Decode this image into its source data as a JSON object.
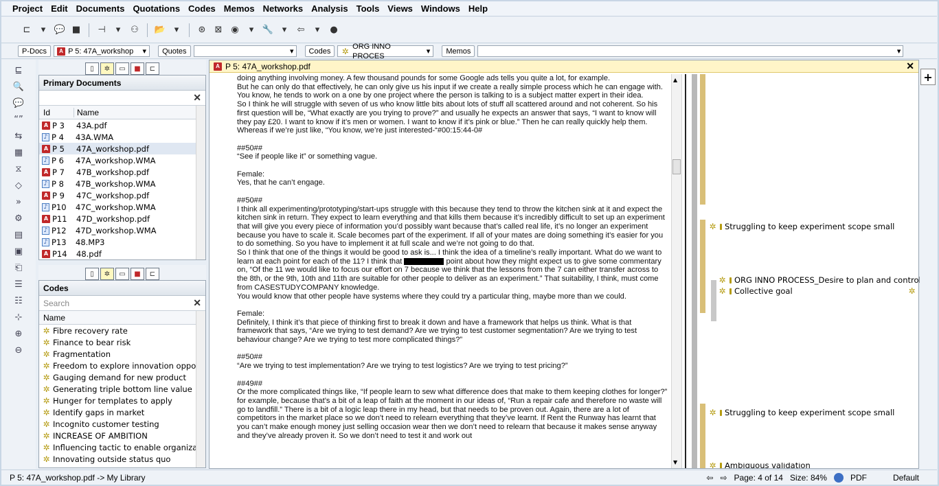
{
  "menu": [
    "Project",
    "Edit",
    "Documents",
    "Quotations",
    "Codes",
    "Memos",
    "Networks",
    "Analysis",
    "Tools",
    "Views",
    "Windows",
    "Help"
  ],
  "managers": {
    "pdocs_label": "P-Docs",
    "pdoc_selected": "P 5: 47A_workshop",
    "quotes_label": "Quotes",
    "codes_label": "Codes",
    "code_selected": "ORG INNO PROCES",
    "memos_label": "Memos"
  },
  "primary_documents": {
    "title": "Primary Documents",
    "col_id": "Id",
    "col_name": "Name",
    "rows": [
      {
        "id": "P 3",
        "name": "43A.pdf",
        "type": "pdf"
      },
      {
        "id": "P 4",
        "name": "43A.WMA",
        "type": "wma"
      },
      {
        "id": "P 5",
        "name": "47A_workshop.pdf",
        "type": "pdf"
      },
      {
        "id": "P 6",
        "name": "47A_workshop.WMA",
        "type": "wma"
      },
      {
        "id": "P 7",
        "name": "47B_workshop.pdf",
        "type": "pdf"
      },
      {
        "id": "P 8",
        "name": "47B_workshop.WMA",
        "type": "wma"
      },
      {
        "id": "P 9",
        "name": "47C_workshop.pdf",
        "type": "pdf"
      },
      {
        "id": "P10",
        "name": "47C_workshop.WMA",
        "type": "wma"
      },
      {
        "id": "P11",
        "name": "47D_workshop.pdf",
        "type": "pdf"
      },
      {
        "id": "P12",
        "name": "47D_workshop.WMA",
        "type": "wma"
      },
      {
        "id": "P13",
        "name": "48.MP3",
        "type": "wma"
      },
      {
        "id": "P14",
        "name": "48.pdf",
        "type": "pdf"
      }
    ]
  },
  "codes_panel": {
    "title": "Codes",
    "search_placeholder": "Search",
    "col_name": "Name",
    "items": [
      "Fibre recovery rate",
      "Finance to bear risk",
      "Fragmentation",
      "Freedom to explore innovation oppo...",
      "Gauging demand for new product",
      "Generating triple bottom line value",
      "Hunger for templates to apply",
      "Identify gaps in market",
      "Incognito customer testing",
      "INCREASE OF AMBITION",
      "Influencing tactic to enable organiza...",
      "Innovating outside status quo"
    ]
  },
  "document": {
    "title": "P 5: 47A_workshop.pdf",
    "paragraphs": [
      "doing anything involving money. A few thousand pounds for some Google ads tells you quite a lot, for example.",
      "But he can only do that effectively, he can only give us his input if we create a really simple process which he can engage with. You know, he tends to work on a one by one project where the person is talking to is a subject matter expert in their idea.",
      "So I think he will struggle with seven of us who know little bits about lots of stuff all scattered around and not coherent. So his first question will be, “What exactly are you trying to prove?” and usually he expects an answer that says, “I want to know will they pay £20. I want to know if it’s men or women. I want to know if it’s pink or blue.” Then he can really quickly help them.",
      "Whereas if we’re just like, “You know, we’re just interested-“#00:15:44-0#",
      "",
      "##50##",
      "“See if people like it” or something vague.",
      "",
      "Female:",
      "Yes, that he can’t engage.",
      "",
      "##50##",
      "I think all experimenting/prototyping/start-ups struggle with this because they tend to throw the kitchen sink at it and expect the kitchen sink in return. They expect to learn everything and that kills them because it’s incredibly difficult to set up an experiment that will give you every piece of information you’d possibly want because that’s called real life, it’s no longer an experiment because you have to scale it. Scale becomes part of the experiment. If all of your mates are doing something it’s easier for you to do something. So you have to implement it at full scale and we’re not going to do that."
    ],
    "para_redacted_before": "So I think that one of the things it would be good to ask is... I think the idea of a timeline’s really important. What do we want to learn at each point for each of the 11? I think that",
    "para_redacted_after": "point about how they might expect us to give some commentary on, “Of the 11 we would like to focus our effort on 7 because we think that the lessons from the 7 can either transfer across to the 8th, or the 9th, 10th and 11th are suitable for other people to deliver as an experiment.” That suitability, I think, must come from CASESTUDYCOMPANY knowledge.",
    "paragraphs2": [
      "You would know that other people have systems where they could try a particular thing, maybe more than we could.",
      "",
      "Female:",
      "Definitely, I think it’s that piece of thinking first to break it down and have a framework that helps us think. What is that framework that says, “Are we trying to test demand? Are we trying to test customer segmentation? Are we trying to test behaviour change? Are we trying to test more complicated things?”",
      "",
      "##50##",
      "“Are we trying to test implementation? Are we trying to test logistics? Are we trying to test pricing?”",
      "",
      "##49##",
      "Or the more complicated things like, “If people learn to sew what difference does that make to them keeping clothes for longer?” for example, because that’s a bit of a leap of faith at the moment in our ideas of, “Run a repair cafe and therefore no waste will go to landfill.” There is a bit of a logic leap there in my head, but that needs to be proven out. Again, there are a lot of competitors in the market place so we don’t need to relearn everything that they’ve learnt. If Rent the Runway has learnt that you can’t make enough money just selling occasion wear then we don’t need to relearn that because it makes sense anyway and they’ve already proven it. So we don’t need to test it and work out"
    ]
  },
  "margin_codes": [
    "Struggling to keep experiment scope small",
    "ORG INNO PROCESS_Desire to plan and control",
    "Collective goal",
    "Struggling to keep experiment scope small",
    "Ambiguous validation"
  ],
  "status": {
    "path": "P 5: 47A_workshop.pdf -> My Library",
    "page": "Page: 4 of 14",
    "size": "Size: 84%",
    "format": "PDF",
    "mode": "Default"
  },
  "colors": {
    "title_bar": "#fff5c8",
    "code_bar": "#d9bf78",
    "code_bar_gray": "#b8b8b8",
    "pdf_red": "#c0282a"
  }
}
